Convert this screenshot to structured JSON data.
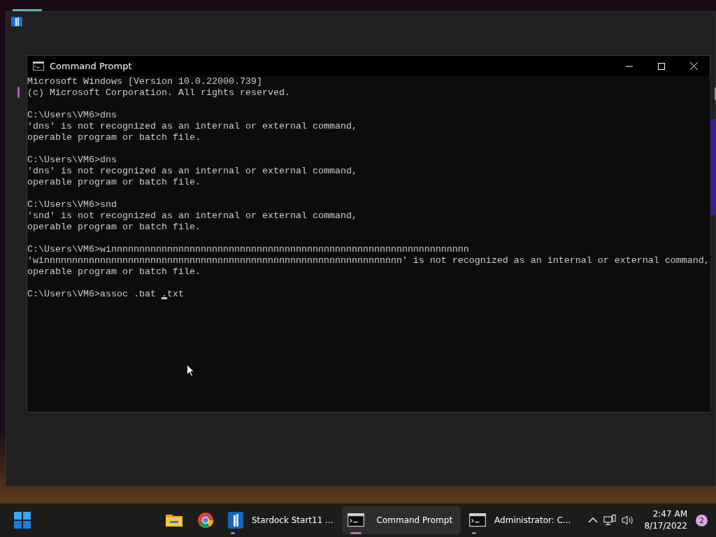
{
  "window": {
    "title": "Command Prompt"
  },
  "console": {
    "blocks": [
      {
        "lines": [
          "Microsoft Windows [Version 10.0.22000.739]",
          "(c) Microsoft Corporation. All rights reserved."
        ]
      },
      {
        "lines": [
          "C:\\Users\\VM6>dns",
          "'dns' is not recognized as an internal or external command,",
          "operable program or batch file."
        ]
      },
      {
        "lines": [
          "C:\\Users\\VM6>dns",
          "'dns' is not recognized as an internal or external command,",
          "operable program or batch file."
        ]
      },
      {
        "lines": [
          "C:\\Users\\VM6>snd",
          "'snd' is not recognized as an internal or external command,",
          "operable program or batch file."
        ]
      },
      {
        "lines": [
          "C:\\Users\\VM6>winnnnnnnnnnnnnnnnnnnnnnnnnnnnnnnnnnnnnnnnnnnnnnnnnnnnnnnnnnnnnnnn",
          "'winnnnnnnnnnnnnnnnnnnnnnnnnnnnnnnnnnnnnnnnnnnnnnnnnnnnnnnnnnnnnnnn' is not recognized as an internal or external command,",
          "operable program or batch file."
        ]
      }
    ],
    "input": {
      "before": "C:\\Users\\VM6>assoc .bat ",
      "at_cursor": ".",
      "after": "txt"
    }
  },
  "taskbar": {
    "apps": [
      {
        "kind": "explorer",
        "running": false,
        "selected": false
      },
      {
        "kind": "browser",
        "running": false,
        "selected": false
      },
      {
        "kind": "launcher",
        "label": "Stardock Start11 ...",
        "running": true,
        "selected": false
      },
      {
        "kind": "terminal",
        "label": "Command Prompt",
        "running": true,
        "selected": true
      },
      {
        "kind": "terminal",
        "label": "Administrator: C...",
        "running": true,
        "selected": false
      }
    ],
    "time": "2:47 AM",
    "date": "8/17/2022",
    "notification_count": "2"
  }
}
